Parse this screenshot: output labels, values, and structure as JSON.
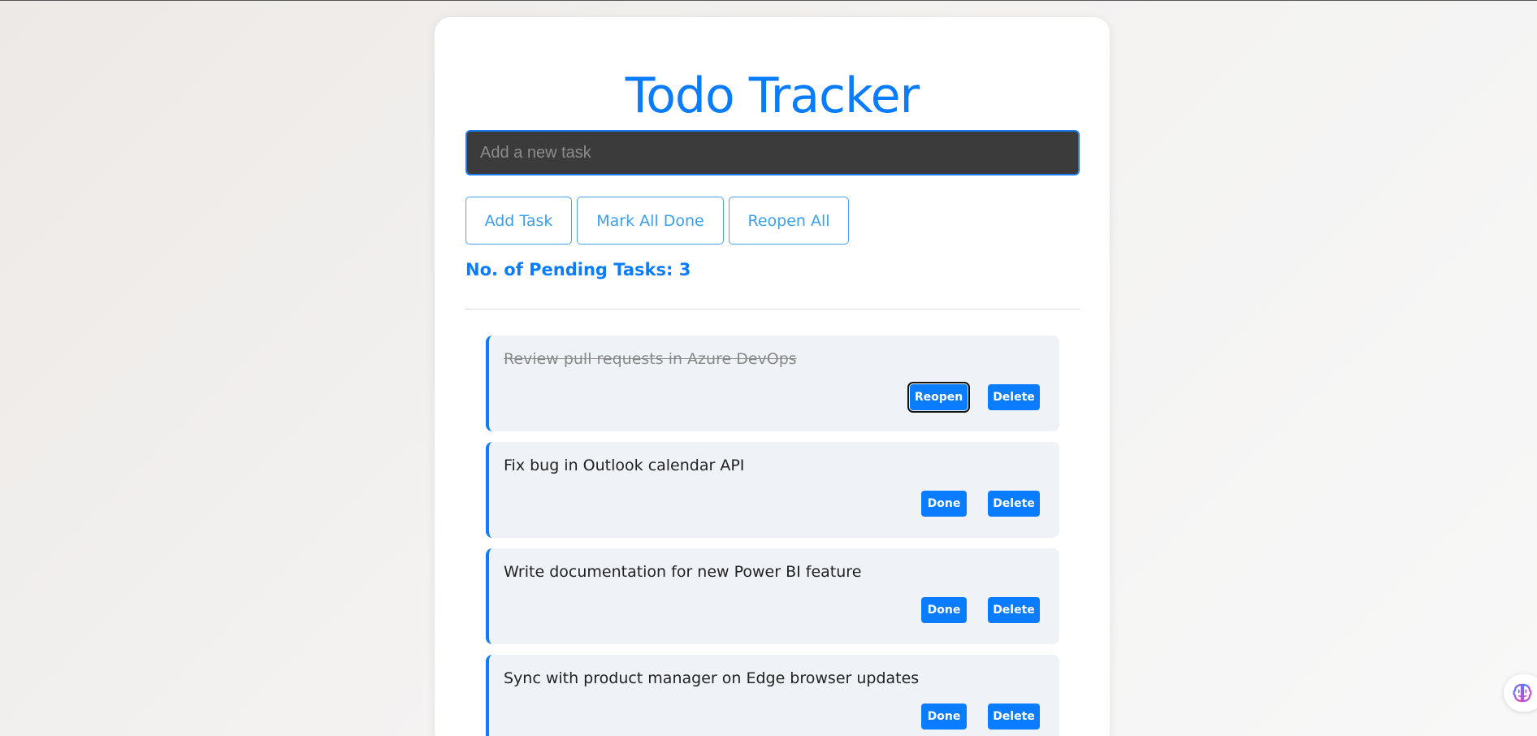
{
  "app": {
    "title": "Todo Tracker"
  },
  "input": {
    "placeholder": "Add a new task",
    "value": ""
  },
  "toolbar": {
    "add_label": "Add Task",
    "mark_all_label": "Mark All Done",
    "reopen_all_label": "Reopen All"
  },
  "pending": {
    "text": "No. of Pending Tasks: 3",
    "count": 3
  },
  "tasks": [
    {
      "text": "Review pull requests in Azure DevOps",
      "completed": true,
      "action_label": "Reopen",
      "delete_label": "Delete"
    },
    {
      "text": "Fix bug in Outlook calendar API",
      "completed": false,
      "action_label": "Done",
      "delete_label": "Delete"
    },
    {
      "text": "Write documentation for new Power BI feature",
      "completed": false,
      "action_label": "Done",
      "delete_label": "Delete"
    },
    {
      "text": "Sync with product manager on Edge browser updates",
      "completed": false,
      "action_label": "Done",
      "delete_label": "Delete"
    }
  ],
  "colors": {
    "accent": "#0a7cff",
    "outline_button": "#3a9ff0",
    "task_background": "#eff2f6",
    "input_background": "#3b3b3b"
  },
  "icons": {
    "floating": "copilot-brain-icon"
  }
}
